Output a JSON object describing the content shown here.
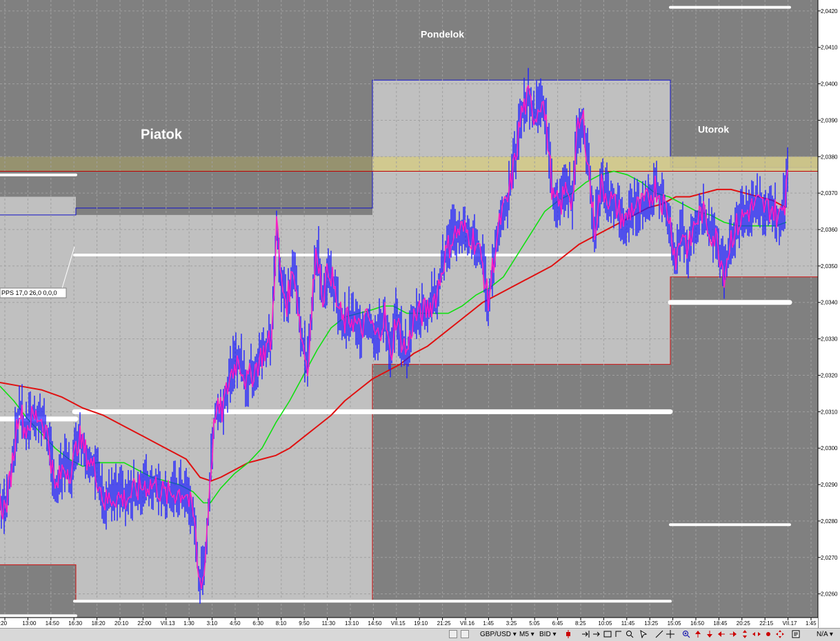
{
  "chart_data": {
    "type": "line",
    "symbol": "GBP/USD",
    "timeframe": "M5",
    "price_type": "BID",
    "y_ticks": [
      "2,0260",
      "2,0270",
      "2,0280",
      "2,0290",
      "2,0300",
      "2,0310",
      "2,0320",
      "2,0330",
      "2,0340",
      "2,0350",
      "2,0360",
      "2,0370",
      "2,0380",
      "2,0390",
      "2,0400",
      "2,0410",
      "2,0420"
    ],
    "ylim": [
      2.02535,
      2.0423
    ],
    "x_ticks": [
      ":20",
      "13:00",
      "14:50",
      "16:30",
      "18:20",
      "20:10",
      "22:00",
      "VII.13",
      "1:30",
      "3:10",
      "4:50",
      "6:30",
      "8:10",
      "9:50",
      "11:30",
      "13:10",
      "14:50",
      "VII.15",
      "19:10",
      "21:25",
      "VII.16",
      "1:45",
      "3:25",
      "5:05",
      "6:45",
      "8:25",
      "10:05",
      "11:45",
      "13:25",
      "15:05",
      "16:50",
      "18:45",
      "20:25",
      "22:15",
      "VII.17",
      "1:45"
    ],
    "day_labels": {
      "friday": "Piatok",
      "monday": "Pondelok",
      "tuesday": "Utorok"
    },
    "price_badges": {
      "upper": "2,0376",
      "lower": "2,0347"
    },
    "indicator_label": "PPS 17,0  26,0  0,0,0",
    "price_path": [
      [
        0,
        2.0285
      ],
      [
        8,
        2.0283
      ],
      [
        18,
        2.0296
      ],
      [
        28,
        2.0312
      ],
      [
        36,
        2.0305
      ],
      [
        46,
        2.0308
      ],
      [
        58,
        2.0309
      ],
      [
        70,
        2.0303
      ],
      [
        80,
        2.0288
      ],
      [
        92,
        2.0295
      ],
      [
        104,
        2.0294
      ],
      [
        114,
        2.0303
      ],
      [
        126,
        2.0298
      ],
      [
        140,
        2.0293
      ],
      [
        152,
        2.0285
      ],
      [
        166,
        2.0287
      ],
      [
        180,
        2.0286
      ],
      [
        196,
        2.0288
      ],
      [
        210,
        2.029
      ],
      [
        224,
        2.029
      ],
      [
        240,
        2.0287
      ],
      [
        256,
        2.0288
      ],
      [
        270,
        2.0288
      ],
      [
        282,
        2.028
      ],
      [
        288,
        2.0264
      ],
      [
        296,
        2.0265
      ],
      [
        304,
        2.029
      ],
      [
        312,
        2.031
      ],
      [
        322,
        2.031
      ],
      [
        334,
        2.032
      ],
      [
        346,
        2.0325
      ],
      [
        358,
        2.0318
      ],
      [
        370,
        2.0322
      ],
      [
        384,
        2.0327
      ],
      [
        394,
        2.033
      ],
      [
        401,
        2.0362
      ],
      [
        408,
        2.0345
      ],
      [
        416,
        2.034
      ],
      [
        426,
        2.035
      ],
      [
        436,
        2.0332
      ],
      [
        446,
        2.0322
      ],
      [
        454,
        2.0344
      ],
      [
        460,
        2.0355
      ],
      [
        468,
        2.0342
      ],
      [
        478,
        2.035
      ],
      [
        488,
        2.034
      ],
      [
        498,
        2.0334
      ],
      [
        510,
        2.0336
      ],
      [
        522,
        2.0332
      ],
      [
        534,
        2.0336
      ],
      [
        546,
        2.033
      ],
      [
        558,
        2.0337
      ],
      [
        566,
        2.0324
      ],
      [
        574,
        2.0336
      ],
      [
        582,
        2.033
      ],
      [
        590,
        2.0326
      ],
      [
        600,
        2.0336
      ],
      [
        612,
        2.0337
      ],
      [
        624,
        2.0339
      ],
      [
        634,
        2.0343
      ],
      [
        644,
        2.0352
      ],
      [
        656,
        2.0358
      ],
      [
        668,
        2.036
      ],
      [
        680,
        2.0359
      ],
      [
        692,
        2.0356
      ],
      [
        700,
        2.035
      ],
      [
        708,
        2.034
      ],
      [
        716,
        2.0352
      ],
      [
        726,
        2.0363
      ],
      [
        736,
        2.0368
      ],
      [
        746,
        2.0378
      ],
      [
        756,
        2.0392
      ],
      [
        766,
        2.0396
      ],
      [
        776,
        2.0391
      ],
      [
        786,
        2.0397
      ],
      [
        794,
        2.0385
      ],
      [
        802,
        2.0368
      ],
      [
        812,
        2.0366
      ],
      [
        822,
        2.0372
      ],
      [
        830,
        2.0368
      ],
      [
        838,
        2.0388
      ],
      [
        846,
        2.039
      ],
      [
        854,
        2.0376
      ],
      [
        862,
        2.036
      ],
      [
        872,
        2.0372
      ],
      [
        882,
        2.0369
      ],
      [
        894,
        2.0366
      ],
      [
        906,
        2.0362
      ],
      [
        916,
        2.0366
      ],
      [
        928,
        2.0366
      ],
      [
        940,
        2.0368
      ],
      [
        950,
        2.0372
      ],
      [
        960,
        2.0368
      ],
      [
        970,
        2.0364
      ],
      [
        980,
        2.0352
      ],
      [
        990,
        2.036
      ],
      [
        998,
        2.0354
      ],
      [
        1008,
        2.0362
      ],
      [
        1018,
        2.0365
      ],
      [
        1028,
        2.036
      ],
      [
        1040,
        2.0357
      ],
      [
        1050,
        2.0348
      ],
      [
        1060,
        2.0358
      ],
      [
        1072,
        2.0362
      ],
      [
        1084,
        2.0365
      ],
      [
        1098,
        2.0367
      ],
      [
        1110,
        2.0366
      ],
      [
        1120,
        2.0366
      ],
      [
        1130,
        2.0363
      ],
      [
        1138,
        2.0368
      ],
      [
        1142,
        2.0378
      ]
    ],
    "ma_green": [
      [
        0,
        2.0317
      ],
      [
        20,
        2.0313
      ],
      [
        40,
        2.0308
      ],
      [
        60,
        2.0304
      ],
      [
        80,
        2.03
      ],
      [
        100,
        2.0297
      ],
      [
        120,
        2.0295
      ],
      [
        140,
        2.0296
      ],
      [
        160,
        2.0296
      ],
      [
        180,
        2.0296
      ],
      [
        200,
        2.0294
      ],
      [
        220,
        2.0292
      ],
      [
        240,
        2.0291
      ],
      [
        260,
        2.029
      ],
      [
        280,
        2.0288
      ],
      [
        295,
        2.0285
      ],
      [
        305,
        2.0285
      ],
      [
        320,
        2.0289
      ],
      [
        340,
        2.0293
      ],
      [
        360,
        2.0296
      ],
      [
        380,
        2.03
      ],
      [
        400,
        2.0307
      ],
      [
        420,
        2.0313
      ],
      [
        440,
        2.032
      ],
      [
        460,
        2.0327
      ],
      [
        480,
        2.0333
      ],
      [
        500,
        2.0336
      ],
      [
        520,
        2.0337
      ],
      [
        540,
        2.0338
      ],
      [
        556,
        2.0339
      ],
      [
        570,
        2.0339
      ],
      [
        590,
        2.0337
      ],
      [
        610,
        2.0337
      ],
      [
        630,
        2.0337
      ],
      [
        650,
        2.0337
      ],
      [
        670,
        2.0339
      ],
      [
        690,
        2.0342
      ],
      [
        710,
        2.0344
      ],
      [
        730,
        2.0347
      ],
      [
        750,
        2.0353
      ],
      [
        770,
        2.0359
      ],
      [
        790,
        2.0365
      ],
      [
        810,
        2.0368
      ],
      [
        830,
        2.037
      ],
      [
        850,
        2.0373
      ],
      [
        870,
        2.0375
      ],
      [
        890,
        2.0376
      ],
      [
        910,
        2.0375
      ],
      [
        930,
        2.0373
      ],
      [
        950,
        2.037
      ],
      [
        970,
        2.0369
      ],
      [
        990,
        2.0367
      ],
      [
        1010,
        2.0365
      ],
      [
        1030,
        2.0364
      ],
      [
        1050,
        2.0362
      ],
      [
        1070,
        2.0361
      ],
      [
        1090,
        2.0361
      ],
      [
        1110,
        2.0361
      ],
      [
        1125,
        2.0361
      ],
      [
        1140,
        2.0362
      ]
    ],
    "ma_red": [
      [
        0,
        2.0318
      ],
      [
        30,
        2.0317
      ],
      [
        60,
        2.0316
      ],
      [
        90,
        2.0314
      ],
      [
        120,
        2.0311
      ],
      [
        150,
        2.0309
      ],
      [
        180,
        2.0306
      ],
      [
        210,
        2.0303
      ],
      [
        240,
        2.03
      ],
      [
        270,
        2.0297
      ],
      [
        290,
        2.0292
      ],
      [
        306,
        2.0291
      ],
      [
        320,
        2.0292
      ],
      [
        340,
        2.0294
      ],
      [
        360,
        2.0296
      ],
      [
        380,
        2.0297
      ],
      [
        400,
        2.0298
      ],
      [
        420,
        2.03
      ],
      [
        440,
        2.0303
      ],
      [
        460,
        2.0306
      ],
      [
        480,
        2.0309
      ],
      [
        500,
        2.0313
      ],
      [
        520,
        2.0316
      ],
      [
        540,
        2.0319
      ],
      [
        560,
        2.0321
      ],
      [
        580,
        2.0323
      ],
      [
        600,
        2.0326
      ],
      [
        620,
        2.0328
      ],
      [
        640,
        2.0331
      ],
      [
        660,
        2.0334
      ],
      [
        680,
        2.0337
      ],
      [
        700,
        2.034
      ],
      [
        720,
        2.0342
      ],
      [
        740,
        2.0344
      ],
      [
        760,
        2.0346
      ],
      [
        780,
        2.0348
      ],
      [
        800,
        2.035
      ],
      [
        820,
        2.0353
      ],
      [
        840,
        2.0356
      ],
      [
        860,
        2.0358
      ],
      [
        880,
        2.036
      ],
      [
        900,
        2.0362
      ],
      [
        920,
        2.0364
      ],
      [
        940,
        2.0366
      ],
      [
        960,
        2.0367
      ],
      [
        980,
        2.0369
      ],
      [
        1000,
        2.0369
      ],
      [
        1020,
        2.037
      ],
      [
        1040,
        2.0371
      ],
      [
        1060,
        2.0371
      ],
      [
        1080,
        2.037
      ],
      [
        1100,
        2.0369
      ],
      [
        1120,
        2.0368
      ],
      [
        1140,
        2.0366
      ]
    ],
    "pivot_levels": {
      "friday": {
        "x": [
          0,
          110
        ],
        "high": 2.0375,
        "mid": 2.0309,
        "low": 2.0253
      },
      "friday_full": {
        "x": [
          110,
          540
        ],
        "high": 2.0353,
        "mid": 2.031,
        "low": 2.0258
      },
      "monday": {
        "x": [
          540,
          972
        ],
        "high": 2.0353,
        "mid": 2.031,
        "low": 2.0258
      },
      "tuesday": {
        "x": [
          972,
          1145
        ],
        "high": 2.0421,
        "mid": 2.034,
        "low": 2.0279
      }
    }
  },
  "toolbar": {
    "symbol": "GBP/USD ▾",
    "timeframe": "M5 ▾",
    "price_type": "BID ▾",
    "zoom": "N/A ▾"
  }
}
